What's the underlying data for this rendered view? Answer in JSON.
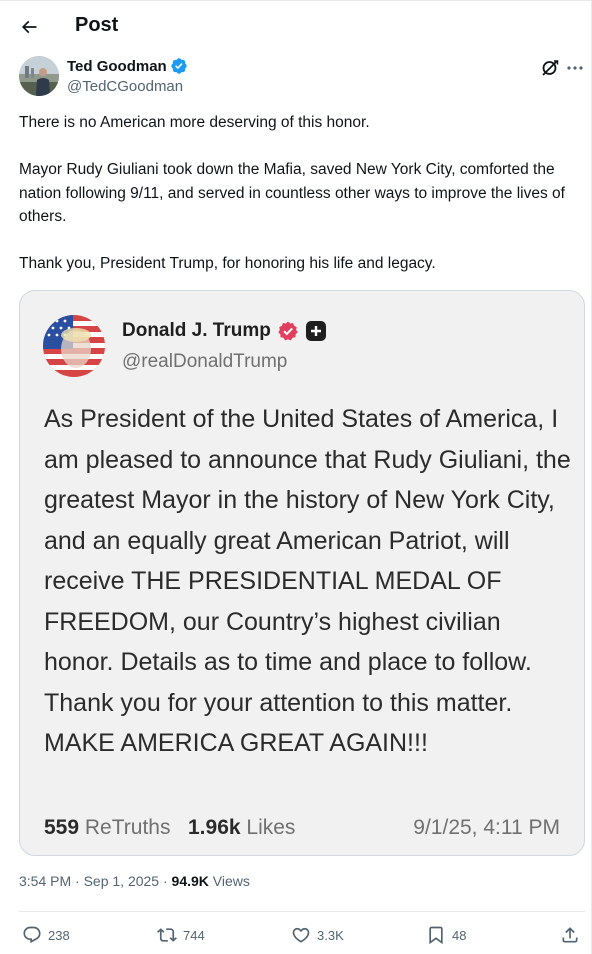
{
  "header": {
    "title": "Post"
  },
  "author": {
    "name": "Ted Goodman",
    "handle": "@TedCGoodman"
  },
  "tweet": {
    "paragraphs": [
      "There is no American more deserving of this honor.",
      "Mayor Rudy Giuliani took down the Mafia, saved New York City, comforted the nation following 9/11, and served in countless other ways to improve the lives of others.",
      "Thank you, President Trump, for honoring his life and legacy."
    ]
  },
  "quote": {
    "name": "Donald J. Trump",
    "handle": "@realDonaldTrump",
    "text": "As President of the United States of America, I am pleased to announce that Rudy Giuliani, the greatest Mayor in the history of New York City, and an equally great American Patriot, will receive THE PRESIDENTIAL MEDAL OF FREEDOM, our Country’s highest civilian honor. Details as to time and place to follow. Thank you for your attention to this matter.  MAKE AMERICA GREAT AGAIN!!!",
    "retruths_count": "559",
    "retruths_label": "ReTruths",
    "likes_count": "1.96k",
    "likes_label": "Likes",
    "date": "9/1/25, 4:11 PM"
  },
  "meta": {
    "time_date": "3:54 PM · Sep 1, 2025 · ",
    "views_count": "94.9K",
    "views_label": " Views"
  },
  "actions": {
    "replies": "238",
    "reposts": "744",
    "likes": "3.3K",
    "bookmarks": "48"
  },
  "colors": {
    "verified_blue": "#1d9bf0",
    "truth_verified": "#e0405e",
    "text_primary": "#0f1419",
    "text_secondary": "#536471"
  },
  "icons": [
    "back-arrow-icon",
    "verified-badge-icon",
    "grok-icon",
    "more-icon",
    "reply-icon",
    "repost-icon",
    "like-icon",
    "bookmark-icon",
    "share-icon"
  ]
}
